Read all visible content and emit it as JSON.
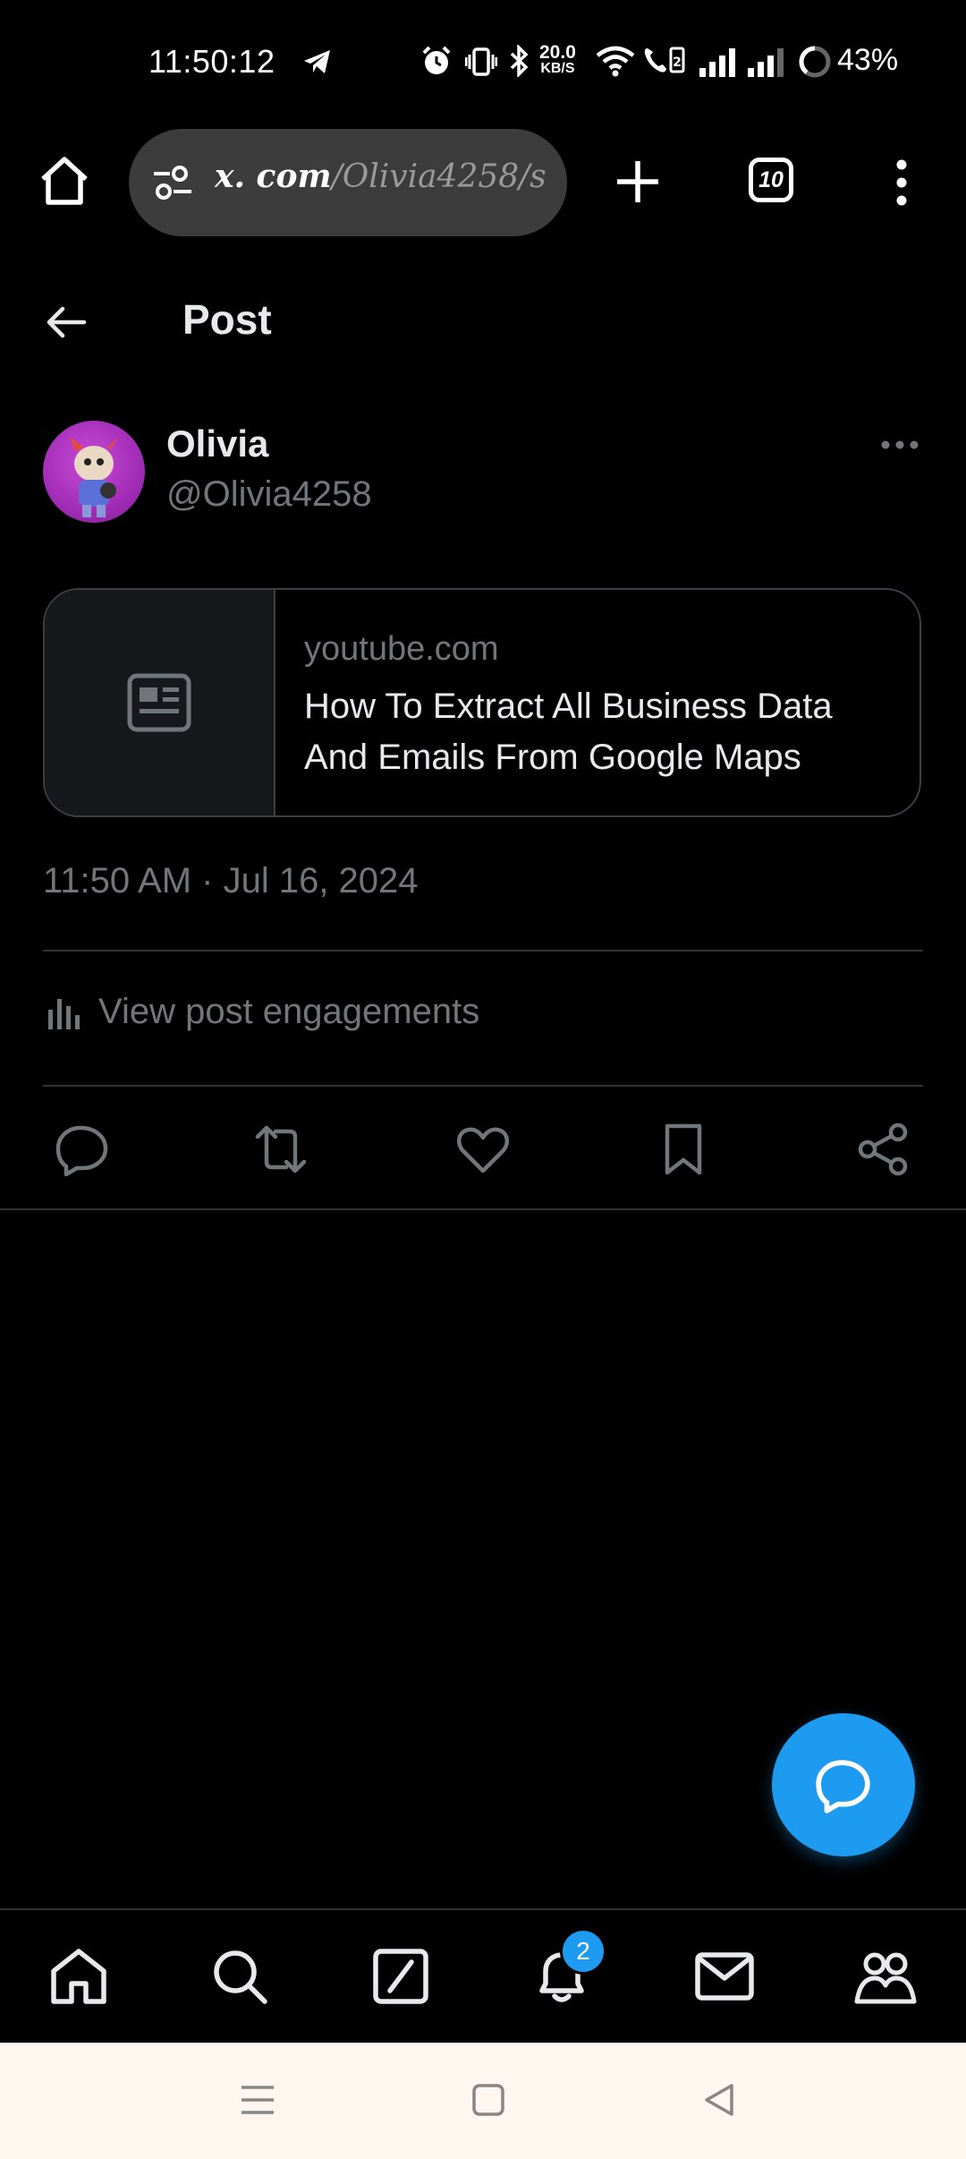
{
  "status_bar": {
    "time": "11:50:12",
    "net_speed_value": "20.0",
    "net_speed_unit": "KB/S",
    "battery": "43%"
  },
  "browser": {
    "url_host": "x. com",
    "url_path": "/Olivia4258/s",
    "tab_count": "10"
  },
  "header": {
    "title": "Post"
  },
  "post": {
    "author_name": "Olivia",
    "author_handle": "@Olivia4258",
    "card": {
      "domain": "youtube.com",
      "title": "How To Extract All Business Data And Emails From Google Maps"
    },
    "timestamp": "11:50 AM · Jul 16, 2024",
    "engagements_label": "View post engagements"
  },
  "tabbar": {
    "notifications_badge": "2"
  },
  "colors": {
    "accent": "#1d9bf0",
    "background": "#000000",
    "muted_text": "#71767b",
    "divider": "#2f3336"
  },
  "icons": [
    "telegram-icon",
    "alarm-icon",
    "vibrate-icon",
    "bluetooth-icon",
    "wifi-icon",
    "volte-icon",
    "signal-icon",
    "battery-ring-icon",
    "home-icon",
    "site-settings-icon",
    "plus-icon",
    "more-vertical-icon",
    "back-arrow-icon",
    "more-horizontal-icon",
    "article-icon",
    "stats-icon",
    "reply-icon",
    "repost-icon",
    "like-icon",
    "bookmark-icon",
    "share-icon",
    "compose-reply-icon",
    "search-icon",
    "grok-icon",
    "bell-icon",
    "mail-icon",
    "communities-icon"
  ]
}
